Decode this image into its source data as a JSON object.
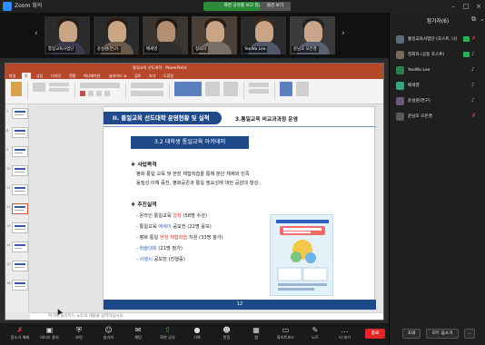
{
  "window": {
    "app_title": "Zoom 회의",
    "banner_text": "화면 공유를 보고 있습니다",
    "view_button": "옵션 보기"
  },
  "gallery": [
    {
      "name": "통일교육사업단"
    },
    {
      "name": "윤성원(연구)"
    },
    {
      "name": "배세영"
    },
    {
      "name": "정회자"
    },
    {
      "name": "YeoWo Lee"
    },
    {
      "name": "윤남호 오은경"
    }
  ],
  "ppt": {
    "title": "통일교육 선도대학 - PowerPoint",
    "tabs": [
      "파일",
      "홈",
      "삽입",
      "디자인",
      "전환",
      "애니메이션",
      "슬라이드 쇼",
      "검토",
      "보기",
      "도움말"
    ],
    "active_tab": "홈",
    "notes_placeholder": "여기에 슬라이드 노트의 내용을 입력하십시오"
  },
  "slide": {
    "header": "II. 통일교육 선도대학 운영현황 및 실적",
    "section": "3.통일교육 비교과과정 운영",
    "subtitle": "3.2 대학생 통일교육 아카데미",
    "bullet1": "사업목적",
    "purpose1": "평화·통일 교육 및 현장 체험학습을 통해 분단 체제와 민족",
    "purpose2": "동질성 이해 증진, 평화공존과 통일 필요성에 대한 공감대 형성",
    "bullet2": "추진실적",
    "items": [
      {
        "pre": "- 온라인 통일교육 ",
        "hl": "강좌",
        "post": " (58명 수강)",
        "cls": "hl-red"
      },
      {
        "pre": "- 통일교육 ",
        "hl": "에세이",
        "post": " 공모전 (22명 응모)",
        "cls": "hl-blue"
      },
      {
        "pre": "- 평화·통일 ",
        "hl": "현장 체험학습",
        "post": " 지원 (33명 참가)",
        "cls": "hl-red"
      },
      {
        "pre": "- ",
        "hl": "학술대회",
        "post": " (21명 참가)",
        "cls": "hl-blue"
      },
      {
        "pre": "- ",
        "hl": "사행시",
        "post": " 공모전 (진행중)",
        "cls": "hl-blue"
      }
    ],
    "page_number": "12"
  },
  "participants": {
    "title": "참가자(6)",
    "list": [
      {
        "name": "통일교육사업단 (호스트, 나)",
        "avatar_color": "#5a6b7c",
        "mic_muted": true,
        "camera_on": true
      },
      {
        "name": "정회자 (공동 호스트)",
        "avatar_color": "#7a6a5a",
        "mic_muted": false,
        "camera_on": true
      },
      {
        "name": "YeoWo Lee",
        "avatar_color": "#2f7d4f",
        "mic_muted": false,
        "camera_on": false
      },
      {
        "name": "배세영",
        "avatar_color": "#3aa37a",
        "mic_muted": false,
        "camera_on": false
      },
      {
        "name": "윤성원(연구)",
        "avatar_color": "#6a5a7a",
        "mic_muted": false,
        "camera_on": false
      },
      {
        "name": "윤남호 오은경",
        "avatar_color": "#5a5a5a",
        "mic_muted": true,
        "camera_on": false
      }
    ],
    "invite_button": "초대",
    "mute_all_button": "모두 음소거",
    "more_button": "..."
  },
  "toolbar": {
    "items": [
      {
        "label": "음소거 해제",
        "icon": "microphone-muted-icon",
        "color": "red"
      },
      {
        "label": "비디오 중지",
        "icon": "video-camera-icon",
        "color": ""
      },
      {
        "label": "보안",
        "icon": "shield-icon",
        "color": ""
      },
      {
        "label": "참가자",
        "icon": "participants-icon",
        "color": ""
      },
      {
        "label": "채팅",
        "icon": "chat-icon",
        "color": ""
      },
      {
        "label": "화면 공유",
        "icon": "share-screen-icon",
        "color": "green"
      },
      {
        "label": "기록",
        "icon": "record-icon",
        "color": ""
      },
      {
        "label": "반응",
        "icon": "reaction-icon",
        "color": ""
      },
      {
        "label": "앱",
        "icon": "apps-icon",
        "color": ""
      },
      {
        "label": "화이트보드",
        "icon": "whiteboard-icon",
        "color": ""
      },
      {
        "label": "노트",
        "icon": "notes-icon",
        "color": ""
      },
      {
        "label": "더 보기",
        "icon": "more-icon",
        "color": ""
      }
    ],
    "end_button": "종료"
  }
}
